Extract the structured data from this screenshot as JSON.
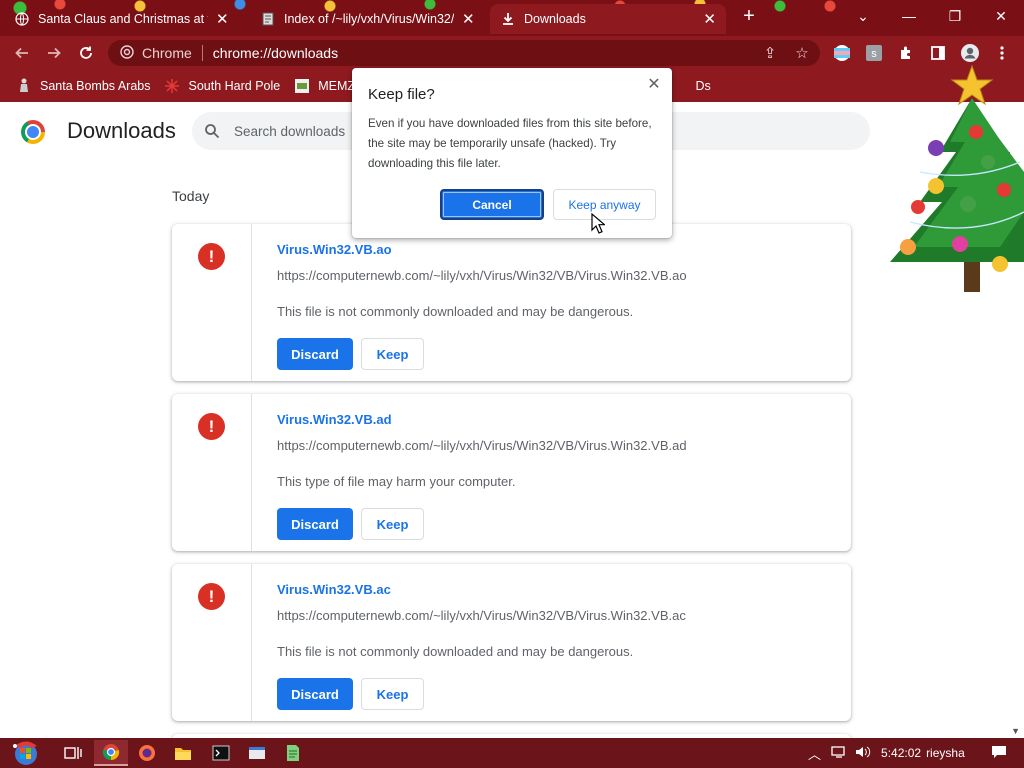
{
  "tabs": [
    {
      "label": "Santa Claus and Christmas at the",
      "close": "✕"
    },
    {
      "label": "Index of /~lily/vxh/Virus/Win32/",
      "close": "✕"
    },
    {
      "label": "Downloads",
      "close": "✕"
    }
  ],
  "window_controls": {
    "dropdown": "⌄",
    "minimize": "—",
    "restore": "❐",
    "close": "✕"
  },
  "omnibox": {
    "site_label": "Chrome",
    "url": "chrome://downloads"
  },
  "bookmarks": [
    "Santa Bombs Arabs",
    "South Hard Pole",
    "MEMZ C",
    "Ds"
  ],
  "page": {
    "title": "Downloads",
    "search_placeholder": "Search downloads",
    "section_label": "Today"
  },
  "downloads": [
    {
      "name": "Virus.Win32.VB.ao",
      "url": "https://computernewb.com/~lily/vxh/Virus/Win32/VB/Virus.Win32.VB.ao",
      "warning": "This file is not commonly downloaded and may be dangerous.",
      "discard_label": "Discard",
      "keep_label": "Keep"
    },
    {
      "name": "Virus.Win32.VB.ad",
      "url": "https://computernewb.com/~lily/vxh/Virus/Win32/VB/Virus.Win32.VB.ad",
      "warning": "This type of file may harm your computer.",
      "discard_label": "Discard",
      "keep_label": "Keep"
    },
    {
      "name": "Virus.Win32.VB.ac",
      "url": "https://computernewb.com/~lily/vxh/Virus/Win32/VB/Virus.Win32.VB.ac",
      "warning": "This file is not commonly downloaded and may be dangerous.",
      "discard_label": "Discard",
      "keep_label": "Keep"
    }
  ],
  "dialog": {
    "title": "Keep file?",
    "body": "Even if you have downloaded files from this site before, the site may be temporarily unsafe (hacked). Try downloading this file later.",
    "cancel_label": "Cancel",
    "keep_anyway_label": "Keep anyway",
    "close": "✕"
  },
  "taskbar": {
    "clock": "5:42:02",
    "user": "rieysha"
  },
  "colors": {
    "titlebar": "#7a0f16",
    "toolbar": "#8e1a20",
    "accent": "#1a73e8",
    "danger": "#d93025"
  }
}
